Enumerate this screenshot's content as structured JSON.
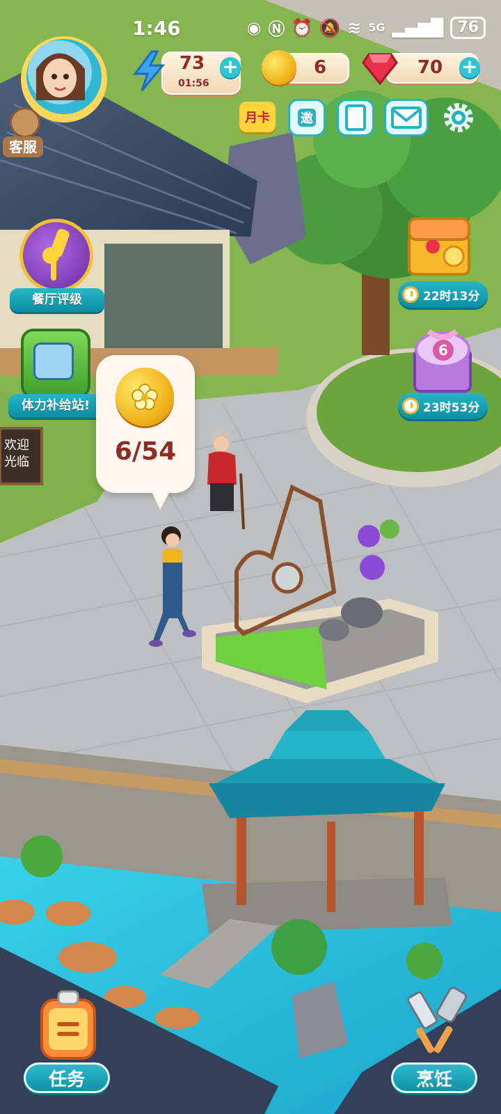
{
  "status_bar": {
    "time": "1:46",
    "network": "5G",
    "battery": "76"
  },
  "resources": {
    "energy": {
      "value": "73",
      "timer": "01:56",
      "icon": "lightning-icon"
    },
    "coins": {
      "value": "6",
      "icon": "coin-icon"
    },
    "gems": {
      "value": "70",
      "icon": "gem-icon"
    }
  },
  "top_buttons": {
    "customer_service": "客服",
    "monthly_card": "月卡",
    "invite": "邀"
  },
  "left_features": {
    "restaurant_rating": "餐厅评级",
    "energy_station": "体力补给站!"
  },
  "right_timers": {
    "treasure_timer": "22时13分",
    "gift_badge": "6",
    "gift_timer": "23时53分"
  },
  "coin_bubble": {
    "progress": "6/54"
  },
  "sign": {
    "text": "欢迎光临"
  },
  "bottom_nav": {
    "tasks": "任务",
    "cooking": "烹饪"
  },
  "colors": {
    "accent": "#1ba9ba",
    "value_text": "#8f2b21",
    "gold": "#f0b51b"
  }
}
